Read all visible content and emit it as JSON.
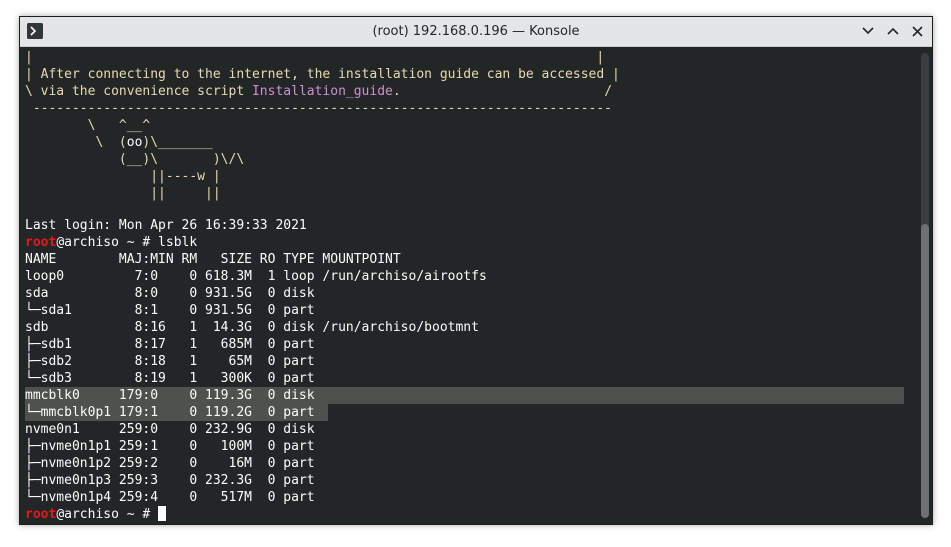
{
  "window": {
    "title": "(root) 192.168.0.196 — Konsole"
  },
  "terminal": {
    "lines": [
      {
        "id": "l0",
        "text": "|                                                                        |"
      },
      {
        "id": "l1",
        "text": "| After connecting to the internet, the installation guide can be accessed |"
      },
      {
        "id": "l2a",
        "text": "\\ via the convenience script "
      },
      {
        "id": "l2b",
        "text": "Installation_guide"
      },
      {
        "id": "l2c",
        "text": ".                          /"
      },
      {
        "id": "l3",
        "text": " --------------------------------------------------------------------------"
      },
      {
        "id": "c1",
        "text": "        \\   ^__^"
      },
      {
        "id": "c2a",
        "text": "         \\  ("
      },
      {
        "id": "c2b",
        "text": "oo"
      },
      {
        "id": "c2c",
        "text": ")\\_______"
      },
      {
        "id": "c3",
        "text": "            (__)\\       )\\/\\"
      },
      {
        "id": "c4",
        "text": "                ||----w |"
      },
      {
        "id": "c5",
        "text": "                ||     ||"
      },
      {
        "id": "login",
        "text": "Last login: Mon Apr 26 16:39:33 2021"
      },
      {
        "id": "p1a",
        "text": "root"
      },
      {
        "id": "p1b",
        "text": "@archiso ~ # lsblk"
      },
      {
        "id": "hdr",
        "text": "NAME        MAJ:MIN RM   SIZE RO TYPE MOUNTPOINT"
      },
      {
        "id": "r1",
        "text": "loop0         7:0    0 618.3M  1 loop /run/archiso/airootfs"
      },
      {
        "id": "r2",
        "text": "sda           8:0    0 931.5G  0 disk"
      },
      {
        "id": "r3",
        "text": "└─sda1        8:1    0 931.5G  0 part"
      },
      {
        "id": "r4",
        "text": "sdb           8:16   1  14.3G  0 disk /run/archiso/bootmnt"
      },
      {
        "id": "r5",
        "text": "├─sdb1        8:17   1   685M  0 part"
      },
      {
        "id": "r6",
        "text": "├─sdb2        8:18   1    65M  0 part"
      },
      {
        "id": "r7",
        "text": "└─sdb3        8:19   1   300K  0 part"
      },
      {
        "id": "r8",
        "text": "mmcblk0     179:0    0 119.3G  0 disk"
      },
      {
        "id": "r9",
        "text": "└─mmcblk0p1 179:1    0 119.2G  0 part"
      },
      {
        "id": "r10",
        "text": "nvme0n1     259:0    0 232.9G  0 disk"
      },
      {
        "id": "r11",
        "text": "├─nvme0n1p1 259:1    0   100M  0 part"
      },
      {
        "id": "r12",
        "text": "├─nvme0n1p2 259:2    0    16M  0 part"
      },
      {
        "id": "r13",
        "text": "├─nvme0n1p3 259:3    0 232.3G  0 part"
      },
      {
        "id": "r14",
        "text": "└─nvme0n1p4 259:4    0   517M  0 part"
      },
      {
        "id": "p2a",
        "text": "root"
      },
      {
        "id": "p2b",
        "text": "@archiso ~ # "
      }
    ]
  },
  "colors": {
    "background": "#232627",
    "foreground": "#fcfcfc",
    "art": "#e9d9b0",
    "link": "#cf8ed0",
    "prompt_user": "#ed1515",
    "selection": "#4e524e"
  },
  "icons": {
    "app": "konsole-terminal-icon",
    "minimize": "chevron-down-icon",
    "maximize": "chevron-up-icon",
    "close": "close-x-icon"
  }
}
